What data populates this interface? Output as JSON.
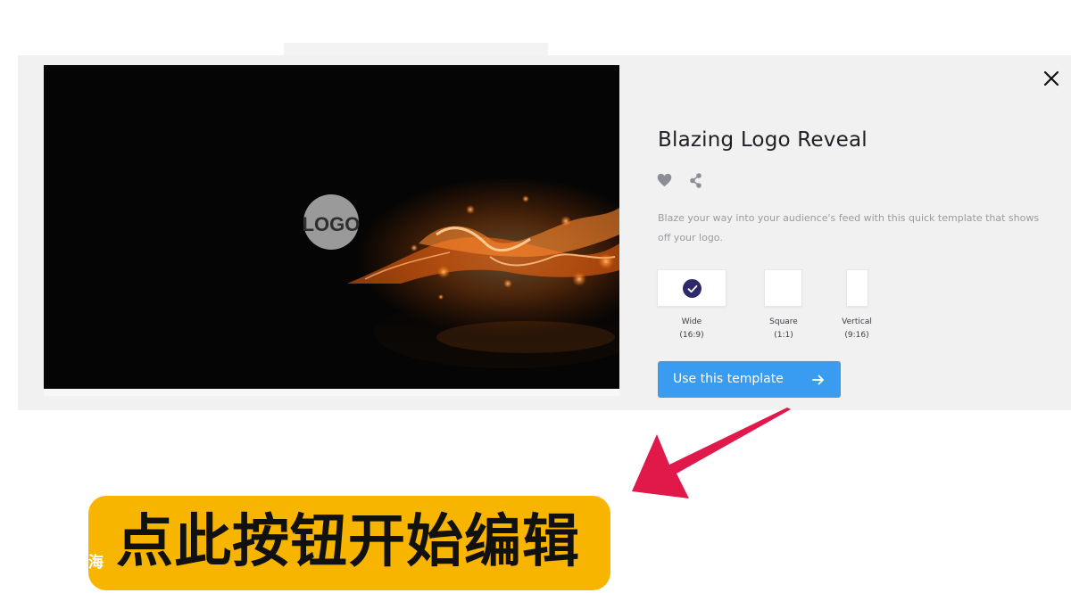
{
  "modal": {
    "title": "Blazing Logo Reveal",
    "description": "Blaze your way into your audience's feed with this quick template that shows off your logo.",
    "preview": {
      "logo_text": "LOGO"
    },
    "icons": {
      "close": "close-icon",
      "favorite": "heart-icon",
      "share": "share-icon"
    },
    "aspect_ratios": [
      {
        "label": "Wide",
        "ratio": "(16:9)",
        "selected": true
      },
      {
        "label": "Square",
        "ratio": "(1:1)",
        "selected": false
      },
      {
        "label": "Vertical",
        "ratio": "(9:16)",
        "selected": false
      }
    ],
    "use_template_label": "Use this template"
  },
  "overlay": {
    "caption": "点此按钮开始编辑",
    "watermark": "海"
  },
  "colors": {
    "primary_button": "#3a9cf1",
    "check_badge": "#2d2a6b",
    "banner": "#f7b500",
    "pointer_arrow": "#e0194a"
  }
}
